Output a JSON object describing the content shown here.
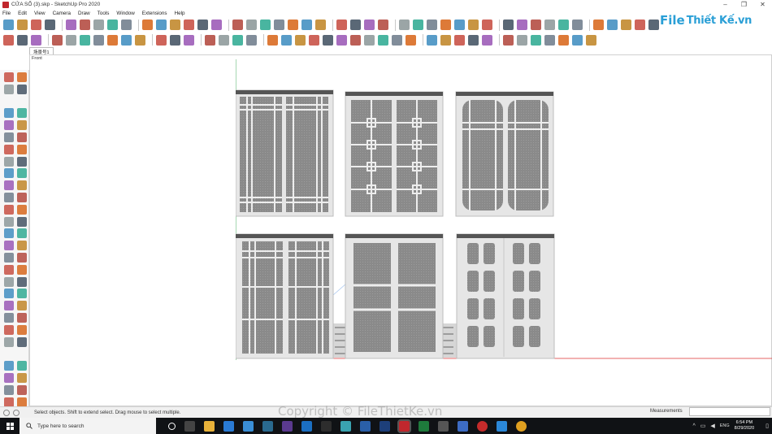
{
  "window": {
    "title": "CỬA SỔ (3).skp - SketchUp Pro 2020",
    "controls": [
      "–",
      "❐",
      "✕"
    ]
  },
  "menu": [
    "File",
    "Edit",
    "View",
    "Camera",
    "Draw",
    "Tools",
    "Window",
    "Extensions",
    "Help"
  ],
  "brand": {
    "mark": "File",
    "text": "Thiết Kế.vn",
    "color": "#2a9fd6"
  },
  "scene_tab": "场景号1",
  "viewport_label": "Front",
  "status": {
    "hint": "Select objects. Shift to extend select. Drag mouse to select multiple.",
    "measurements_label": "Measurements",
    "measurements_value": ""
  },
  "watermark": "Copyright © FileThietKe.vn",
  "taskbar": {
    "search_placeholder": "Type here to search",
    "lang": "ENG",
    "time": "6:54 PM",
    "date": "8/29/2020"
  },
  "colors": {
    "accent": "#2a9fd6",
    "glass": "#8a8a8a",
    "frame": "#e6e6e6",
    "taskbar": "#101215"
  }
}
